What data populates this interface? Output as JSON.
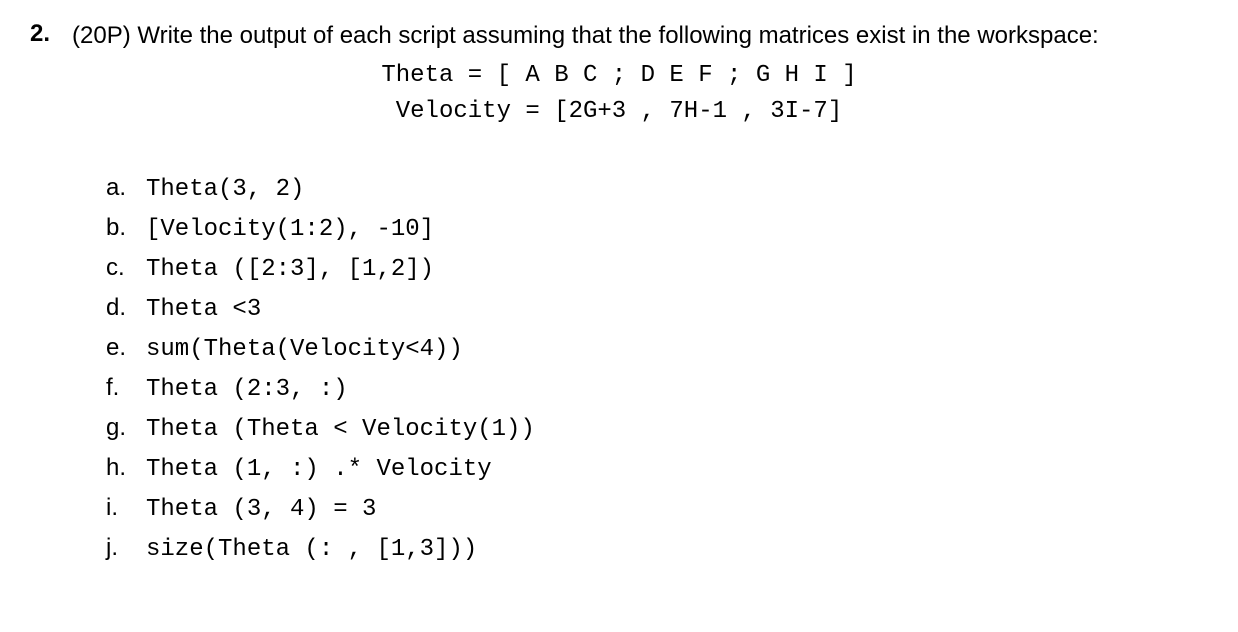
{
  "question": {
    "number": "2.",
    "points_and_text": "(20P) Write the output of each script assuming that the following matrices exist in the workspace:"
  },
  "code_definitions": {
    "line1": "Theta = [ A  B  C ; D  E  F ; G  H  I ]",
    "line2": "Velocity = [2G+3 , 7H-1 , 3I-7]"
  },
  "sub_questions": [
    {
      "label": "a.",
      "code": "Theta(3, 2)"
    },
    {
      "label": "b.",
      "code": "[Velocity(1:2), -10]"
    },
    {
      "label": "c.",
      "code": "Theta ([2:3], [1,2])"
    },
    {
      "label": "d.",
      "code": "Theta <3"
    },
    {
      "label": "e.",
      "code": "sum(Theta(Velocity<4))"
    },
    {
      "label": "f.",
      "code": "Theta (2:3, :)"
    },
    {
      "label": "g.",
      "code": "Theta (Theta < Velocity(1))"
    },
    {
      "label": "h.",
      "code": "Theta (1, :) .* Velocity"
    },
    {
      "label": "i.",
      "code": "Theta (3, 4) = 3"
    },
    {
      "label": "j.",
      "code": "size(Theta (: , [1,3]))"
    }
  ]
}
